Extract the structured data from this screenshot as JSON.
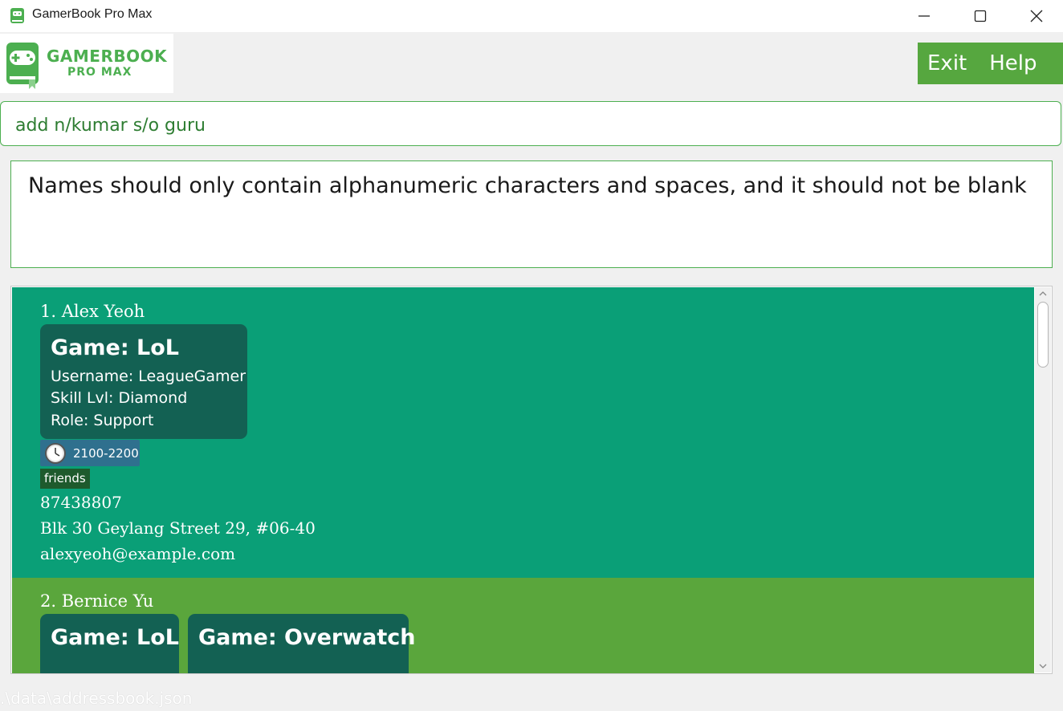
{
  "window": {
    "title": "GamerBook Pro Max",
    "controls": [
      "minimize",
      "maximize",
      "close"
    ]
  },
  "logo": {
    "line1": "GAMERBOOK",
    "line2": "PRO MAX",
    "icon": "controller-book-icon"
  },
  "menu": {
    "items": [
      {
        "label": "Exit"
      },
      {
        "label": "Help"
      }
    ]
  },
  "command": {
    "value": "add n/kumar s/o guru"
  },
  "result": {
    "message": "Names should only contain alphanumeric characters and spaces, and it should not be blank"
  },
  "persons": [
    {
      "index_name": "1. Alex Yeoh",
      "games": [
        {
          "title": "Game: LoL",
          "username": "Username: LeagueGamer",
          "skill": "Skill Lvl: Diamond",
          "role": "Role: Support"
        }
      ],
      "time_slot": "2100-2200",
      "tags": [
        "friends"
      ],
      "phone": "87438807",
      "address": "Blk 30 Geylang Street 29, #06-40",
      "email": "alexyeoh@example.com"
    },
    {
      "index_name": "2. Bernice Yu",
      "games": [
        {
          "title": "Game: LoL"
        },
        {
          "title": "Game: Overwatch"
        }
      ]
    }
  ],
  "status": {
    "path": ".\\data\\addressbook.json"
  },
  "colors": {
    "accent": "#4caf50",
    "menu_bg": "#56a73f",
    "card1_bg": "#0a9f77",
    "card2_bg": "#5aa63c",
    "game_bg": "#136153",
    "time_badge_bg": "#2f708e",
    "tag_bg": "#1e5a2d"
  }
}
